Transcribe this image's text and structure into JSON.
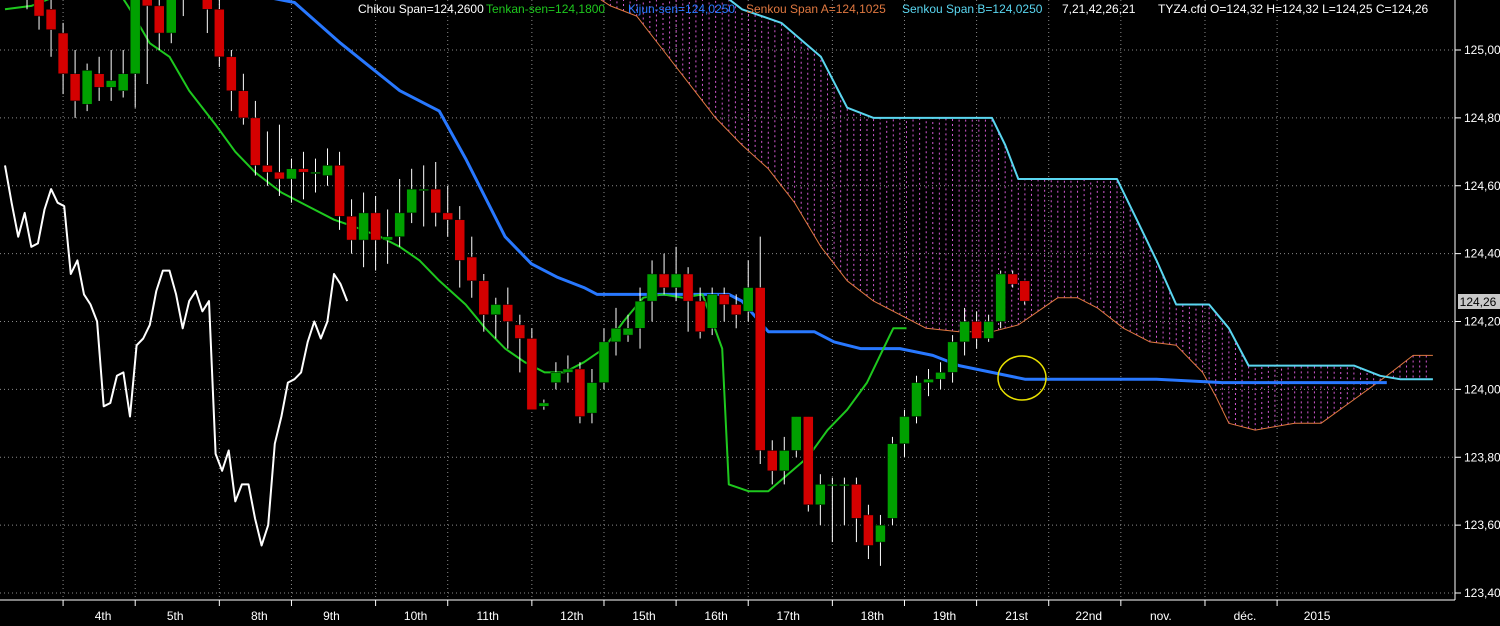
{
  "colors": {
    "background": "#000000",
    "grid": "#8a8a8a",
    "up_candle": "#00a000",
    "down_candle": "#d40000",
    "wick": "#ffffff",
    "chikou": "#ffffff",
    "tenkan": "#1ec81e",
    "kijun": "#2878ff",
    "senkou_a": "#e07840",
    "senkou_b": "#5ad6f0",
    "cloud_hatch": "#d258d2",
    "highlight_circle": "#e8e000",
    "header_text": "#ffffff",
    "price_box": "#c8c8c8"
  },
  "header": {
    "chikou": "Chikou Span=124,2600",
    "tenkan": "Tenkan-sen=124,1800",
    "kijun": "Kijun-sen=124,0250",
    "senkou_a": "Senkou Span A=124,1025",
    "senkou_b": "Senkou Span B=124,0250",
    "params": "7,21,42,26,21",
    "ohlc": "TYZ4.cfd O=124,32 H=124,32 L=124,25 C=124,26"
  },
  "current_price_label": "124,26",
  "chart_data": {
    "type": "candlestick",
    "instrument": "TYZ4.cfd",
    "y_axis": {
      "min": 123.4,
      "max": 125.15,
      "ticks": [
        "125,00",
        "124,80",
        "124,60",
        "124,40",
        "124,20",
        "124,00",
        "123,80",
        "123,60",
        "123,40"
      ],
      "tick_values": [
        125.0,
        124.8,
        124.6,
        124.4,
        124.2,
        124.0,
        123.8,
        123.6,
        123.4
      ]
    },
    "x_axis": {
      "ticks": [
        "4th",
        "5th",
        "8th",
        "9th",
        "10th",
        "11th",
        "12th",
        "15th",
        "16th",
        "17th",
        "18th",
        "19th",
        "21st",
        "22nd",
        "nov.",
        "déc.",
        "2015"
      ],
      "tick_index": [
        4,
        10,
        17,
        23,
        30,
        36,
        43,
        49,
        55,
        61,
        68,
        74,
        80,
        86,
        92,
        99,
        105
      ]
    },
    "grid": true,
    "candles": [
      [
        125.28,
        125.2,
        125.3,
        125.18
      ],
      [
        125.25,
        125.15,
        125.28,
        125.12
      ],
      [
        125.2,
        125.1,
        125.23,
        125.06
      ],
      [
        125.12,
        125.06,
        125.22,
        124.98
      ],
      [
        125.05,
        124.93,
        125.08,
        124.87
      ],
      [
        124.93,
        124.85,
        125.0,
        124.8
      ],
      [
        124.84,
        124.94,
        124.96,
        124.82
      ],
      [
        124.93,
        124.89,
        124.98,
        124.85
      ],
      [
        124.89,
        124.91,
        125.0,
        124.85
      ],
      [
        124.88,
        124.93,
        125.0,
        124.86
      ],
      [
        124.93,
        125.2,
        125.22,
        124.83
      ],
      [
        125.2,
        125.13,
        125.28,
        124.9
      ],
      [
        125.13,
        125.05,
        125.2,
        125.0
      ],
      [
        125.05,
        125.15,
        125.22,
        125.02
      ],
      [
        125.15,
        125.25,
        125.3,
        125.1
      ],
      [
        125.28,
        125.3,
        125.33,
        125.2
      ],
      [
        125.25,
        125.12,
        125.3,
        125.05
      ],
      [
        125.12,
        124.98,
        125.15,
        124.95
      ],
      [
        124.98,
        124.88,
        125.0,
        124.82
      ],
      [
        124.88,
        124.8,
        124.93,
        124.78
      ],
      [
        124.8,
        124.66,
        124.85,
        124.63
      ],
      [
        124.66,
        124.64,
        124.76,
        124.6
      ],
      [
        124.64,
        124.62,
        124.78,
        124.57
      ],
      [
        124.62,
        124.65,
        124.68,
        124.55
      ],
      [
        124.65,
        124.64,
        124.7,
        124.56
      ],
      [
        124.64,
        124.64,
        124.68,
        124.58
      ],
      [
        124.63,
        124.66,
        124.71,
        124.6
      ],
      [
        124.66,
        124.51,
        124.7,
        124.47
      ],
      [
        124.51,
        124.44,
        124.56,
        124.4
      ],
      [
        124.44,
        124.52,
        124.58,
        124.36
      ],
      [
        124.52,
        124.44,
        124.57,
        124.35
      ],
      [
        124.44,
        124.45,
        124.53,
        124.37
      ],
      [
        124.45,
        124.52,
        124.62,
        124.42
      ],
      [
        124.52,
        124.59,
        124.65,
        124.49
      ],
      [
        124.59,
        124.59,
        124.66,
        124.48
      ],
      [
        124.59,
        124.52,
        124.67,
        124.48
      ],
      [
        124.52,
        124.5,
        124.6,
        124.45
      ],
      [
        124.5,
        124.38,
        124.54,
        124.3
      ],
      [
        124.39,
        124.32,
        124.45,
        124.27
      ],
      [
        124.32,
        124.22,
        124.34,
        124.17
      ],
      [
        124.22,
        124.25,
        124.27,
        124.15
      ],
      [
        124.25,
        124.2,
        124.3,
        124.12
      ],
      [
        124.19,
        124.15,
        124.22,
        124.05
      ],
      [
        124.15,
        123.94,
        124.18,
        123.94
      ],
      [
        123.95,
        123.96,
        123.97,
        123.94
      ],
      [
        124.02,
        124.05,
        124.08,
        124.0
      ],
      [
        124.05,
        124.06,
        124.1,
        124.02
      ],
      [
        124.06,
        123.92,
        124.08,
        123.9
      ],
      [
        123.93,
        124.02,
        124.06,
        123.9
      ],
      [
        124.02,
        124.14,
        124.18,
        124.0
      ],
      [
        124.14,
        124.18,
        124.24,
        124.1
      ],
      [
        124.16,
        124.18,
        124.22,
        124.14
      ],
      [
        124.18,
        124.26,
        124.3,
        124.12
      ],
      [
        124.26,
        124.34,
        124.38,
        124.2
      ],
      [
        124.34,
        124.3,
        124.4,
        124.28
      ],
      [
        124.3,
        124.34,
        124.42,
        124.26
      ],
      [
        124.34,
        124.26,
        124.36,
        124.17
      ],
      [
        124.26,
        124.17,
        124.3,
        124.15
      ],
      [
        124.18,
        124.28,
        124.3,
        124.16
      ],
      [
        124.28,
        124.25,
        124.3,
        124.2
      ],
      [
        124.25,
        124.22,
        124.28,
        124.18
      ],
      [
        124.23,
        124.3,
        124.38,
        124.2
      ],
      [
        124.3,
        123.82,
        124.45,
        123.78
      ],
      [
        123.82,
        123.76,
        123.85,
        123.72
      ],
      [
        123.76,
        123.82,
        123.86,
        123.72
      ],
      [
        123.82,
        123.92,
        123.92,
        123.8
      ],
      [
        123.92,
        123.66,
        123.92,
        123.64
      ],
      [
        123.66,
        123.72,
        123.75,
        123.6
      ],
      [
        123.72,
        123.72,
        123.74,
        123.55
      ],
      [
        123.72,
        123.72,
        123.74,
        123.6
      ],
      [
        123.72,
        123.62,
        123.74,
        123.55
      ],
      [
        123.63,
        123.54,
        123.66,
        123.5
      ],
      [
        123.55,
        123.6,
        123.63,
        123.48
      ],
      [
        123.62,
        123.84,
        123.86,
        123.6
      ],
      [
        123.84,
        123.92,
        123.94,
        123.8
      ],
      [
        123.92,
        124.02,
        124.04,
        123.9
      ],
      [
        124.02,
        124.03,
        124.06,
        123.98
      ],
      [
        124.03,
        124.05,
        124.08,
        124.0
      ],
      [
        124.05,
        124.14,
        124.16,
        124.02
      ],
      [
        124.14,
        124.2,
        124.24,
        124.1
      ],
      [
        124.2,
        124.15,
        124.23,
        124.12
      ],
      [
        124.15,
        124.2,
        124.22,
        124.14
      ],
      [
        124.2,
        124.34,
        124.35,
        124.18
      ],
      [
        124.34,
        124.31,
        124.35,
        124.3
      ],
      [
        124.32,
        124.26,
        124.32,
        124.25
      ]
    ],
    "tenkan": [
      [
        0,
        125.12
      ],
      [
        4,
        125.13
      ],
      [
        8,
        125.16
      ],
      [
        12,
        125.2
      ],
      [
        16,
        125.21
      ],
      [
        19,
        125.12
      ],
      [
        22,
        125.02
      ],
      [
        25,
        124.98
      ],
      [
        28,
        124.88
      ],
      [
        32,
        124.78
      ],
      [
        35,
        124.7
      ],
      [
        38,
        124.64
      ],
      [
        42,
        124.58
      ],
      [
        46,
        124.54
      ],
      [
        50,
        124.5
      ],
      [
        53,
        124.48
      ],
      [
        57,
        124.45
      ],
      [
        60,
        124.42
      ],
      [
        63,
        124.38
      ],
      [
        66,
        124.32
      ],
      [
        70,
        124.25
      ],
      [
        73,
        124.18
      ],
      [
        76,
        124.12
      ],
      [
        79,
        124.08
      ],
      [
        82,
        124.05
      ],
      [
        85,
        124.05
      ],
      [
        88,
        124.08
      ],
      [
        91,
        124.12
      ],
      [
        94,
        124.2
      ],
      [
        97,
        124.27
      ],
      [
        100,
        124.28
      ],
      [
        103,
        124.27
      ],
      [
        106,
        124.28
      ],
      [
        109,
        124.12
      ],
      [
        110,
        123.72
      ],
      [
        113,
        123.7
      ],
      [
        116,
        123.7
      ],
      [
        119,
        123.75
      ],
      [
        122,
        123.8
      ],
      [
        125,
        123.88
      ],
      [
        128,
        123.94
      ],
      [
        131,
        124.02
      ],
      [
        133,
        124.1
      ],
      [
        135,
        124.18
      ],
      [
        137,
        124.18
      ]
    ],
    "kijun": [
      [
        0,
        125.4
      ],
      [
        12,
        125.28
      ],
      [
        24,
        125.2
      ],
      [
        30,
        125.18
      ],
      [
        36,
        125.17
      ],
      [
        44,
        125.14
      ],
      [
        51,
        125.02
      ],
      [
        60,
        124.88
      ],
      [
        66,
        124.82
      ],
      [
        70,
        124.68
      ],
      [
        76,
        124.45
      ],
      [
        80,
        124.37
      ],
      [
        84,
        124.33
      ],
      [
        88,
        124.3
      ],
      [
        90,
        124.28
      ],
      [
        100,
        124.28
      ],
      [
        105,
        124.28
      ],
      [
        110,
        124.28
      ],
      [
        112,
        124.26
      ],
      [
        116,
        124.17
      ],
      [
        123,
        124.17
      ],
      [
        126,
        124.14
      ],
      [
        130,
        124.12
      ],
      [
        136,
        124.12
      ],
      [
        141,
        124.1
      ],
      [
        145,
        124.07
      ],
      [
        155,
        124.03
      ],
      [
        165,
        124.03
      ],
      [
        175,
        124.03
      ],
      [
        185,
        124.02
      ],
      [
        210,
        124.02
      ]
    ],
    "senkou_a": [
      [
        83,
        125.3
      ],
      [
        86,
        125.22
      ],
      [
        88,
        125.18
      ],
      [
        92,
        125.13
      ],
      [
        96,
        125.1
      ],
      [
        100,
        125.0
      ],
      [
        104,
        124.9
      ],
      [
        108,
        124.8
      ],
      [
        112,
        124.72
      ],
      [
        116,
        124.65
      ],
      [
        120,
        124.55
      ],
      [
        124,
        124.42
      ],
      [
        128,
        124.32
      ],
      [
        132,
        124.26
      ],
      [
        136,
        124.22
      ],
      [
        140,
        124.18
      ],
      [
        145,
        124.17
      ],
      [
        150,
        124.17
      ],
      [
        154,
        124.19
      ],
      [
        157,
        124.23
      ],
      [
        160,
        124.27
      ],
      [
        163,
        124.27
      ],
      [
        166,
        124.24
      ],
      [
        170,
        124.18
      ],
      [
        174,
        124.14
      ],
      [
        178,
        124.13
      ],
      [
        182,
        124.05
      ],
      [
        184,
        123.98
      ],
      [
        186,
        123.9
      ],
      [
        190,
        123.88
      ],
      [
        196,
        123.9
      ],
      [
        200,
        123.9
      ],
      [
        205,
        123.97
      ],
      [
        210,
        124.04
      ],
      [
        214,
        124.1
      ],
      [
        217,
        124.1
      ]
    ],
    "senkou_b": [
      [
        83,
        125.35
      ],
      [
        88,
        125.25
      ],
      [
        96,
        125.2
      ],
      [
        102,
        125.2
      ],
      [
        108,
        125.18
      ],
      [
        112,
        125.12
      ],
      [
        118,
        125.08
      ],
      [
        124,
        124.98
      ],
      [
        128,
        124.83
      ],
      [
        132,
        124.8
      ],
      [
        145,
        124.8
      ],
      [
        150,
        124.8
      ],
      [
        152,
        124.72
      ],
      [
        154,
        124.62
      ],
      [
        162,
        124.62
      ],
      [
        169,
        124.62
      ],
      [
        172,
        124.5
      ],
      [
        175,
        124.38
      ],
      [
        178,
        124.25
      ],
      [
        183,
        124.25
      ],
      [
        186,
        124.18
      ],
      [
        189,
        124.07
      ],
      [
        196,
        124.07
      ],
      [
        205,
        124.07
      ],
      [
        209,
        124.04
      ],
      [
        212,
        124.03
      ],
      [
        217,
        124.03
      ]
    ],
    "chikou": [
      [
        0,
        124.66
      ],
      [
        1,
        124.55
      ],
      [
        2,
        124.45
      ],
      [
        3,
        124.52
      ],
      [
        4,
        124.42
      ],
      [
        5,
        124.43
      ],
      [
        6,
        124.53
      ],
      [
        7,
        124.59
      ],
      [
        8,
        124.55
      ],
      [
        9,
        124.54
      ],
      [
        10,
        124.34
      ],
      [
        11,
        124.38
      ],
      [
        12,
        124.28
      ],
      [
        13,
        124.25
      ],
      [
        14,
        124.2
      ],
      [
        15,
        123.95
      ],
      [
        16,
        123.96
      ],
      [
        17,
        124.04
      ],
      [
        18,
        124.05
      ],
      [
        19,
        123.92
      ],
      [
        20,
        124.13
      ],
      [
        21,
        124.15
      ],
      [
        22,
        124.19
      ],
      [
        23,
        124.29
      ],
      [
        24,
        124.35
      ],
      [
        25,
        124.35
      ],
      [
        26,
        124.28
      ],
      [
        27,
        124.18
      ],
      [
        28,
        124.26
      ],
      [
        29,
        124.29
      ],
      [
        30,
        124.23
      ],
      [
        31,
        124.26
      ],
      [
        32,
        123.81
      ],
      [
        33,
        123.76
      ],
      [
        34,
        123.82
      ],
      [
        35,
        123.67
      ],
      [
        36,
        123.72
      ],
      [
        37,
        123.72
      ],
      [
        38,
        123.62
      ],
      [
        39,
        123.54
      ],
      [
        40,
        123.6
      ],
      [
        41,
        123.84
      ],
      [
        42,
        123.92
      ],
      [
        43,
        124.02
      ],
      [
        44,
        124.03
      ],
      [
        45,
        124.05
      ],
      [
        46,
        124.14
      ],
      [
        47,
        124.2
      ],
      [
        48,
        124.15
      ],
      [
        49,
        124.2
      ],
      [
        50,
        124.34
      ],
      [
        51,
        124.31
      ],
      [
        52,
        124.26
      ]
    ]
  }
}
